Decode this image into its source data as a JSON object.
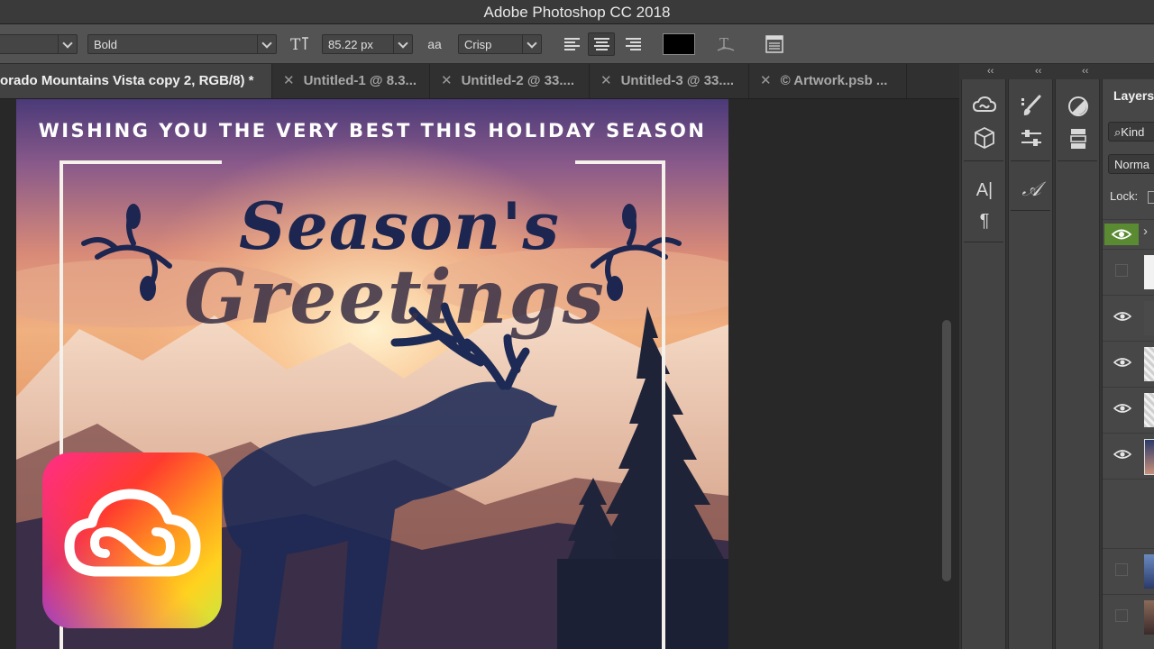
{
  "window": {
    "title": "Adobe Photoshop CC 2018"
  },
  "options_bar": {
    "font_family_value": "",
    "font_style_value": "Bold",
    "font_size_value": "85.22 px",
    "antialias_icon_text": "aa",
    "antialias_value": "Crisp",
    "text_color": "#000000"
  },
  "tabs": [
    {
      "label": "orado Mountains Vista copy 2, RGB/8) *",
      "active": true
    },
    {
      "close": "✕",
      "label": "Untitled-1 @ 8.3..."
    },
    {
      "close": "✕",
      "label": "Untitled-2 @ 33...."
    },
    {
      "close": "✕",
      "label": "Untitled-3 @ 33...."
    },
    {
      "close": "✕",
      "label": "© Artwork.psb ..."
    }
  ],
  "artwork": {
    "message": "WISHING YOU THE VERY BEST THIS HOLIDAY SEASON",
    "headline_line1": "Season's",
    "headline_line2": "Greetings"
  },
  "panels": {
    "collapse_glyph": "‹‹",
    "type_icon_text": "A|",
    "glyphs_icon_text": "𝒜",
    "paragraph_icon_text": "¶"
  },
  "layers_panel": {
    "title": "Layers",
    "filter_kind": "Kind",
    "blend_mode": "Norma",
    "lock_label": "Lock:",
    "group_chevron": "›"
  },
  "colors": {
    "accent_green": "#5a8a32",
    "ui_dark": "#282828",
    "ui_mid": "#535353"
  }
}
